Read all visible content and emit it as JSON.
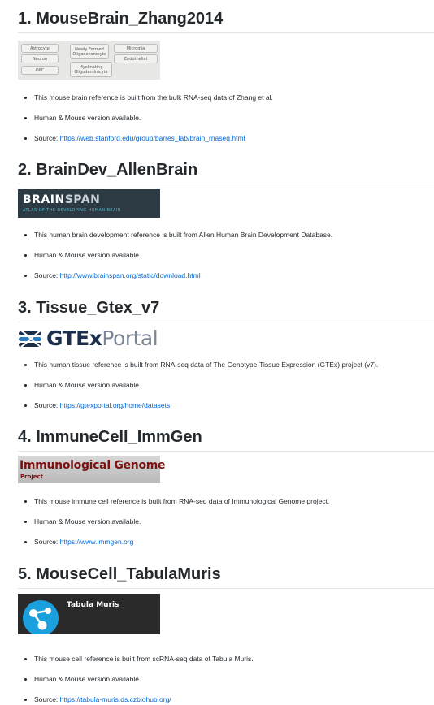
{
  "sections": [
    {
      "heading": "1. MouseBrain_Zhang2014",
      "logo_name": "zhang2014-cell-types",
      "cell_types": [
        "Astrocyte",
        "Newly Formed Oligodendrocyte",
        "Microglia",
        "Neuron",
        "Endothelial",
        "OPC",
        "Myelinating Oligodendrocyte"
      ],
      "bullets": [
        "This mouse brain reference is built from the bulk RNA-seq data of Zhang et al.",
        "Human & Mouse version available."
      ],
      "source_label": "Source: ",
      "source_link": "https://web.stanford.edu/group/barres_lab/brain_rnaseq.html"
    },
    {
      "heading": "2. BrainDev_AllenBrain",
      "logo_title_a": "BRAIN",
      "logo_title_b": "SPAN",
      "logo_sub": "ATLAS OF THE DEVELOPING HUMAN BRAIN",
      "bullets": [
        "This human brain development reference is built from Allen Human Brain Development Database.",
        "Human & Mouse version available."
      ],
      "source_label": "Source: ",
      "source_link": "http://www.brainspan.org/static/download.html"
    },
    {
      "heading": "3. Tissue_Gtex_v7",
      "logo_title_a": "GTEx",
      "logo_title_b": "Portal",
      "bullets": [
        "This human tissue reference is built from RNA-seq data of The Genotype-Tissue Expression (GTEx) project (v7).",
        "Human & Mouse version available."
      ],
      "source_label": "Source: ",
      "source_link": "https://gtexportal.org/home/datasets"
    },
    {
      "heading": "4. ImmuneCell_ImmGen",
      "logo_title_a": "Immunological Genome",
      "logo_sub": "Project",
      "bullets": [
        "This mouse immune cell reference is built from RNA-seq data of Immunological Genome project.",
        "Human & Mouse version available."
      ],
      "source_label": "Source: ",
      "source_link": "https://www.immgen.org"
    },
    {
      "heading": "5. MouseCell_TabulaMuris",
      "logo_title_a": "Tabula Muris",
      "bullets": [
        "This mouse cell reference is built from scRNA-seq data of Tabula Muris.",
        "Human & Mouse version available."
      ],
      "source_label": "Source: ",
      "source_link": "https://tabula-muris.ds.czbiohub.org/"
    }
  ]
}
